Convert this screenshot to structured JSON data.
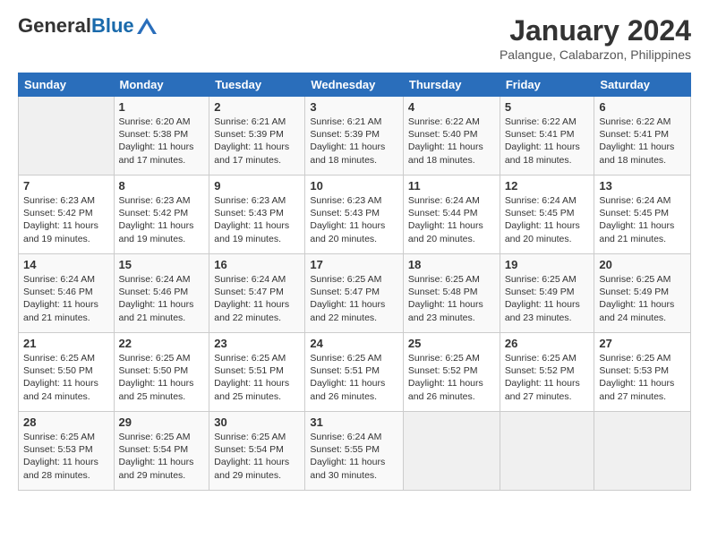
{
  "header": {
    "logo_general": "General",
    "logo_blue": "Blue",
    "main_title": "January 2024",
    "subtitle": "Palangue, Calabarzon, Philippines"
  },
  "calendar": {
    "headers": [
      "Sunday",
      "Monday",
      "Tuesday",
      "Wednesday",
      "Thursday",
      "Friday",
      "Saturday"
    ],
    "weeks": [
      [
        {
          "day": "",
          "info": ""
        },
        {
          "day": "1",
          "info": "Sunrise: 6:20 AM\nSunset: 5:38 PM\nDaylight: 11 hours\nand 17 minutes."
        },
        {
          "day": "2",
          "info": "Sunrise: 6:21 AM\nSunset: 5:39 PM\nDaylight: 11 hours\nand 17 minutes."
        },
        {
          "day": "3",
          "info": "Sunrise: 6:21 AM\nSunset: 5:39 PM\nDaylight: 11 hours\nand 18 minutes."
        },
        {
          "day": "4",
          "info": "Sunrise: 6:22 AM\nSunset: 5:40 PM\nDaylight: 11 hours\nand 18 minutes."
        },
        {
          "day": "5",
          "info": "Sunrise: 6:22 AM\nSunset: 5:41 PM\nDaylight: 11 hours\nand 18 minutes."
        },
        {
          "day": "6",
          "info": "Sunrise: 6:22 AM\nSunset: 5:41 PM\nDaylight: 11 hours\nand 18 minutes."
        }
      ],
      [
        {
          "day": "7",
          "info": "Sunrise: 6:23 AM\nSunset: 5:42 PM\nDaylight: 11 hours\nand 19 minutes."
        },
        {
          "day": "8",
          "info": "Sunrise: 6:23 AM\nSunset: 5:42 PM\nDaylight: 11 hours\nand 19 minutes."
        },
        {
          "day": "9",
          "info": "Sunrise: 6:23 AM\nSunset: 5:43 PM\nDaylight: 11 hours\nand 19 minutes."
        },
        {
          "day": "10",
          "info": "Sunrise: 6:23 AM\nSunset: 5:43 PM\nDaylight: 11 hours\nand 20 minutes."
        },
        {
          "day": "11",
          "info": "Sunrise: 6:24 AM\nSunset: 5:44 PM\nDaylight: 11 hours\nand 20 minutes."
        },
        {
          "day": "12",
          "info": "Sunrise: 6:24 AM\nSunset: 5:45 PM\nDaylight: 11 hours\nand 20 minutes."
        },
        {
          "day": "13",
          "info": "Sunrise: 6:24 AM\nSunset: 5:45 PM\nDaylight: 11 hours\nand 21 minutes."
        }
      ],
      [
        {
          "day": "14",
          "info": "Sunrise: 6:24 AM\nSunset: 5:46 PM\nDaylight: 11 hours\nand 21 minutes."
        },
        {
          "day": "15",
          "info": "Sunrise: 6:24 AM\nSunset: 5:46 PM\nDaylight: 11 hours\nand 21 minutes."
        },
        {
          "day": "16",
          "info": "Sunrise: 6:24 AM\nSunset: 5:47 PM\nDaylight: 11 hours\nand 22 minutes."
        },
        {
          "day": "17",
          "info": "Sunrise: 6:25 AM\nSunset: 5:47 PM\nDaylight: 11 hours\nand 22 minutes."
        },
        {
          "day": "18",
          "info": "Sunrise: 6:25 AM\nSunset: 5:48 PM\nDaylight: 11 hours\nand 23 minutes."
        },
        {
          "day": "19",
          "info": "Sunrise: 6:25 AM\nSunset: 5:49 PM\nDaylight: 11 hours\nand 23 minutes."
        },
        {
          "day": "20",
          "info": "Sunrise: 6:25 AM\nSunset: 5:49 PM\nDaylight: 11 hours\nand 24 minutes."
        }
      ],
      [
        {
          "day": "21",
          "info": "Sunrise: 6:25 AM\nSunset: 5:50 PM\nDaylight: 11 hours\nand 24 minutes."
        },
        {
          "day": "22",
          "info": "Sunrise: 6:25 AM\nSunset: 5:50 PM\nDaylight: 11 hours\nand 25 minutes."
        },
        {
          "day": "23",
          "info": "Sunrise: 6:25 AM\nSunset: 5:51 PM\nDaylight: 11 hours\nand 25 minutes."
        },
        {
          "day": "24",
          "info": "Sunrise: 6:25 AM\nSunset: 5:51 PM\nDaylight: 11 hours\nand 26 minutes."
        },
        {
          "day": "25",
          "info": "Sunrise: 6:25 AM\nSunset: 5:52 PM\nDaylight: 11 hours\nand 26 minutes."
        },
        {
          "day": "26",
          "info": "Sunrise: 6:25 AM\nSunset: 5:52 PM\nDaylight: 11 hours\nand 27 minutes."
        },
        {
          "day": "27",
          "info": "Sunrise: 6:25 AM\nSunset: 5:53 PM\nDaylight: 11 hours\nand 27 minutes."
        }
      ],
      [
        {
          "day": "28",
          "info": "Sunrise: 6:25 AM\nSunset: 5:53 PM\nDaylight: 11 hours\nand 28 minutes."
        },
        {
          "day": "29",
          "info": "Sunrise: 6:25 AM\nSunset: 5:54 PM\nDaylight: 11 hours\nand 29 minutes."
        },
        {
          "day": "30",
          "info": "Sunrise: 6:25 AM\nSunset: 5:54 PM\nDaylight: 11 hours\nand 29 minutes."
        },
        {
          "day": "31",
          "info": "Sunrise: 6:24 AM\nSunset: 5:55 PM\nDaylight: 11 hours\nand 30 minutes."
        },
        {
          "day": "",
          "info": ""
        },
        {
          "day": "",
          "info": ""
        },
        {
          "day": "",
          "info": ""
        }
      ]
    ]
  }
}
